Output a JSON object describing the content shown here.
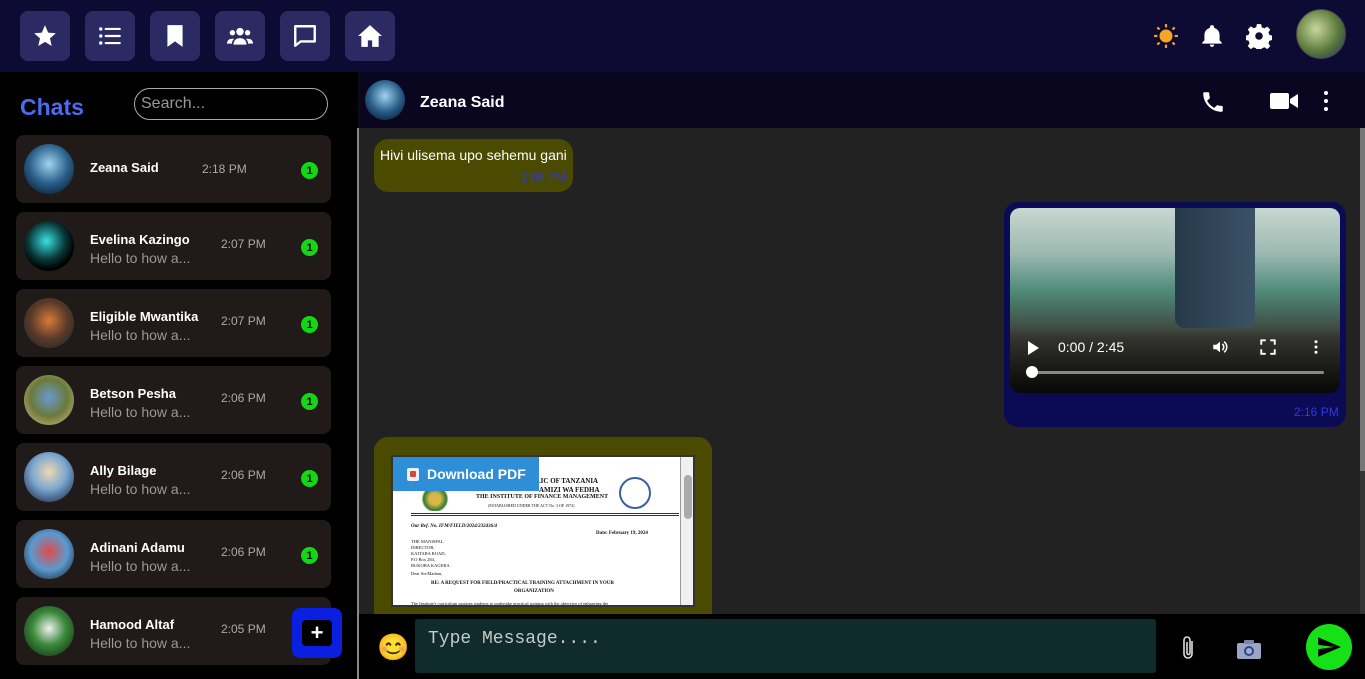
{
  "topbar": {
    "nav": [
      {
        "icon": "star-icon"
      },
      {
        "icon": "list-icon"
      },
      {
        "icon": "bookmark-icon"
      },
      {
        "icon": "users-icon"
      },
      {
        "icon": "message-icon"
      },
      {
        "icon": "home-icon"
      }
    ],
    "right_icons": [
      "sun-icon",
      "bell-icon",
      "gear-icon"
    ],
    "colors": {
      "bar": "#0d0a33",
      "button": "#2c2a62",
      "sun": "#f5a623"
    }
  },
  "sidebar": {
    "title": "Chats",
    "search_placeholder": "Search...",
    "accent": "#4d6bf0",
    "chats": [
      {
        "name": "Zeana Said",
        "preview": "",
        "time": "2:18 PM",
        "unread": "1"
      },
      {
        "name": "Evelina Kazingo",
        "preview": "Hello to how a...",
        "time": "2:07 PM",
        "unread": "1"
      },
      {
        "name": "Eligible Mwantika",
        "preview": "Hello to how a...",
        "time": "2:07 PM",
        "unread": "1"
      },
      {
        "name": "Betson Pesha",
        "preview": "Hello to how a...",
        "time": "2:06 PM",
        "unread": "1"
      },
      {
        "name": "Ally Bilage",
        "preview": "Hello to how a...",
        "time": "2:06 PM",
        "unread": "1"
      },
      {
        "name": "Adinani Adamu",
        "preview": "Hello to how a...",
        "time": "2:06 PM",
        "unread": "1"
      },
      {
        "name": "Hamood Altaf",
        "preview": "Hello to how a...",
        "time": "2:05 PM",
        "unread": ""
      }
    ],
    "fab_label": "+"
  },
  "chat": {
    "contact_name": "Zeana Said",
    "header_icons": [
      "phone-icon",
      "video-camera-icon",
      "more-vertical-icon"
    ],
    "messages": [
      {
        "type": "text",
        "direction": "incoming",
        "text": "Hivi ulisema upo sehemu gani",
        "time": "2:09 PM"
      },
      {
        "type": "video",
        "direction": "outgoing",
        "video_time": "0:00 / 2:45",
        "progress": 0.0,
        "time": "2:16 PM"
      },
      {
        "type": "pdf",
        "direction": "incoming",
        "download_label": "Download PDF",
        "pdf_lines": {
          "header1": "LIC OF TANZANIA",
          "header2": "AMIZI WA FEDHA",
          "header3": "THE INSTITUTE OF FINANCE MANAGEMENT",
          "header4": "(ESTABLISHED UNDER THE ACT No. 3 OF 1972)",
          "ref": "Our Ref. No. IFM/FIELD/2024/232436/4",
          "date": "Date: February 19, 2024",
          "addr1": "THE MANISPAL",
          "addr2": "DIRECTOR,",
          "addr3": "KAITABA ROAD,",
          "addr4": "P.O Box 284,",
          "addr5": "BUKOBA KAGERA.",
          "salutation": "Dear Sir/Madam,",
          "subject1": "RE: A REQUEST FOR FIELD/PRACTICAL TRAINING ATTACHMENT IN YOUR",
          "subject2": "ORGANIZATION",
          "body": "The Institute's curriculum sustains students to undertake practical training with the objective of enhancing the"
        }
      }
    ],
    "colors": {
      "incoming": "#4a4a00",
      "outgoing": "#0b0a55",
      "timestamp": "#2f3ad8",
      "send": "#16e016"
    }
  },
  "composer": {
    "placeholder": "Type Message....",
    "emoji": "😊",
    "icons": [
      "emoji-icon",
      "paperclip-icon",
      "camera-icon",
      "send-icon"
    ]
  }
}
